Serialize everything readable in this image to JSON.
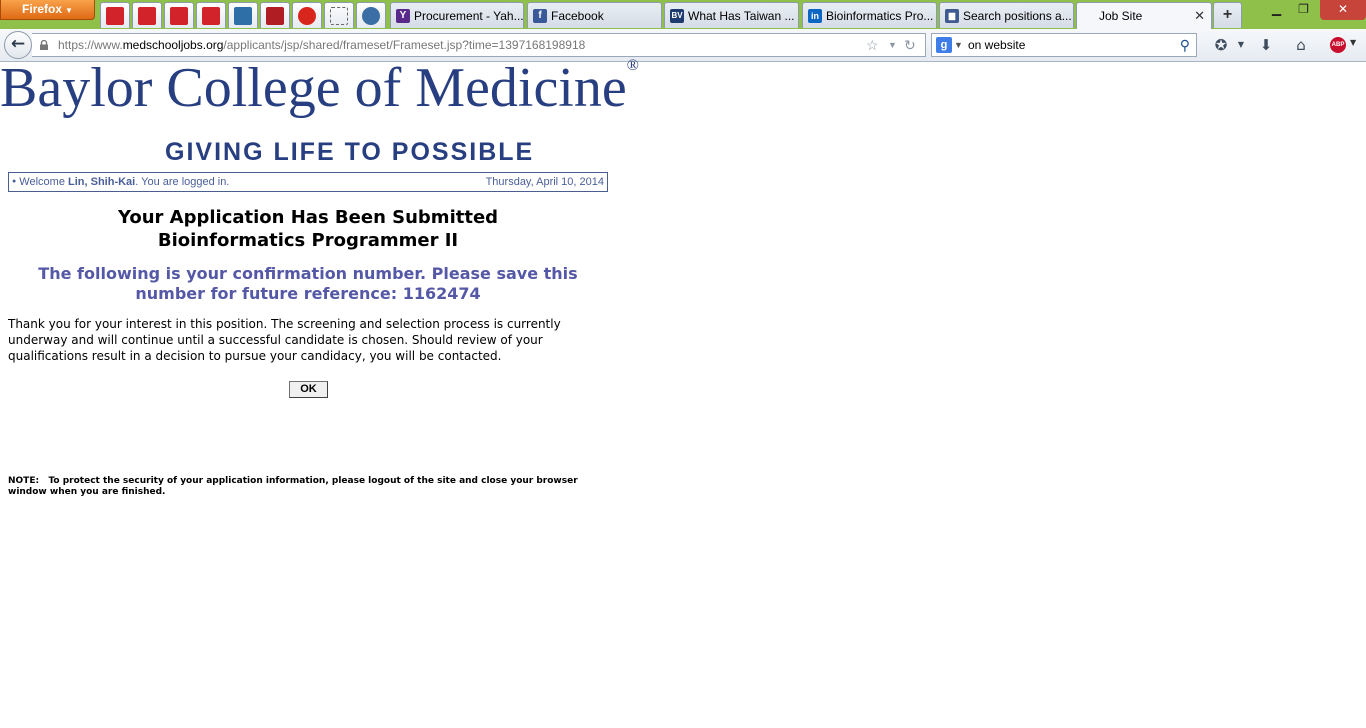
{
  "browser": {
    "menu_button_label": "Firefox",
    "tabs": [
      {
        "label": "Procurement - Yah...",
        "icon": "yahoo-icon",
        "color": "#5a2a8a",
        "glyph": "Y"
      },
      {
        "label": "Facebook",
        "icon": "facebook-icon",
        "color": "#3b5998",
        "glyph": "f"
      },
      {
        "label": "What Has Taiwan ...",
        "icon": "bv-icon",
        "color": "#1d3b6e",
        "glyph": "BV"
      },
      {
        "label": "Bioinformatics Pro...",
        "icon": "linkedin-icon",
        "color": "#0a66c2",
        "glyph": "in"
      },
      {
        "label": "Search positions a...",
        "icon": "book-icon",
        "color": "#3f5a8f",
        "glyph": "▆"
      },
      {
        "label": "Job Site",
        "icon": "",
        "color": "",
        "glyph": ""
      }
    ],
    "active_tab": "Job Site",
    "url_prefix": "https://www.",
    "url_domain": "medschooljobs.org",
    "url_path": "/applicants/jsp/shared/frameset/Frameset.jsp?time=1397168198918",
    "search_value": "on website"
  },
  "page": {
    "logo_title": "Baylor College of Medicine",
    "logo_mark": "®",
    "tagline": "GIVING LIFE TO POSSIBLE",
    "welcome_prefix": "Welcome ",
    "welcome_name": "Lin, Shih-Kai",
    "welcome_suffix": ". You are logged in.",
    "date": "Thursday, April 10, 2014",
    "heading_line1": "Your Application Has Been Submitted",
    "heading_line2": "Bioinformatics Programmer II",
    "confirmation_text": "The following is your confirmation number. Please save this number for future reference: 1162474",
    "body_text": "Thank you for your interest in this position. The screening and selection process is currently underway and will continue until a successful candidate is chosen. Should review of your qualifications result in a decision to pursue your candidacy, you will be contacted.",
    "ok_label": "OK",
    "note_label": "NOTE:",
    "note_text": "To protect the security of your application information, please logout of the site and close your browser window when you are finished."
  }
}
